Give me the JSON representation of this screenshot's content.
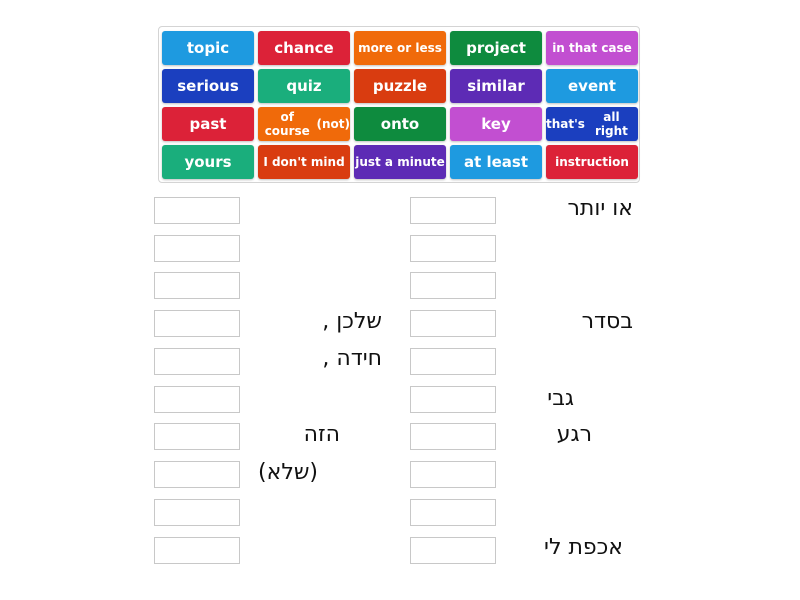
{
  "word_bank": [
    {
      "label": "topic",
      "color": "#1e9ae0"
    },
    {
      "label": "chance",
      "color": "#dc2238"
    },
    {
      "label": "more or less",
      "color": "#f06a0a"
    },
    {
      "label": "project",
      "color": "#0e8b3e"
    },
    {
      "label": "in that case",
      "color": "#c24fd1"
    },
    {
      "label": "serious",
      "color": "#1b3fbf"
    },
    {
      "label": "quiz",
      "color": "#1aae7c"
    },
    {
      "label": "puzzle",
      "color": "#d93c10"
    },
    {
      "label": "similar",
      "color": "#5d2bb5"
    },
    {
      "label": "event",
      "color": "#1e9ae0"
    },
    {
      "label": "past",
      "color": "#dc2238"
    },
    {
      "label": "of course (not)",
      "line1": "of course",
      "line2": "(not)",
      "color": "#f06a0a"
    },
    {
      "label": "onto",
      "color": "#0e8b3e"
    },
    {
      "label": "key",
      "color": "#c24fd1"
    },
    {
      "label": "that's all right",
      "line1": "that's",
      "line2": "all right",
      "color": "#1b3fbf"
    },
    {
      "label": "yours",
      "color": "#1aae7c"
    },
    {
      "label": "I don't mind",
      "color": "#d93c10"
    },
    {
      "label": "just a minute",
      "color": "#5d2bb5"
    },
    {
      "label": "at least",
      "color": "#1e9ae0"
    },
    {
      "label": "instruction",
      "color": "#dc2238"
    }
  ],
  "hebrew": {
    "r0": "או יותר",
    "r3": "בסדר",
    "r5": "גבי",
    "r6": "רגע",
    "r9": "אכפת לי",
    "l3": "שלכן ,",
    "l4": "חידה ,",
    "l6": "הזה",
    "l7": "(שלא)"
  }
}
